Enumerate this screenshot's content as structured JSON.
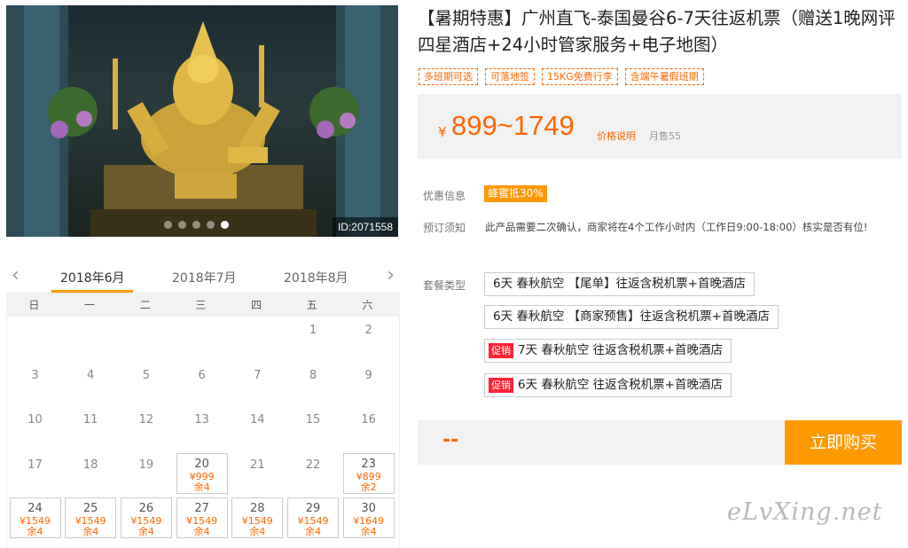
{
  "hero": {
    "id_label": "ID:2071558",
    "slide_count": 5,
    "active_slide": 4
  },
  "calendar": {
    "prev_arrow": "‹",
    "next_arrow": "›",
    "months": [
      "2018年6月",
      "2018年7月",
      "2018年8月"
    ],
    "weekdays": [
      "日",
      "一",
      "二",
      "三",
      "四",
      "五",
      "六"
    ],
    "days": [
      {
        "d": "1"
      },
      {
        "d": "2"
      },
      {
        "d": "3"
      },
      {
        "d": "4"
      },
      {
        "d": "5"
      },
      {
        "d": "6"
      },
      {
        "d": "7"
      },
      {
        "d": "8"
      },
      {
        "d": "9"
      },
      {
        "d": "10"
      },
      {
        "d": "11"
      },
      {
        "d": "12"
      },
      {
        "d": "13"
      },
      {
        "d": "14"
      },
      {
        "d": "15"
      },
      {
        "d": "16"
      },
      {
        "d": "17"
      },
      {
        "d": "18"
      },
      {
        "d": "19"
      },
      {
        "d": "20",
        "price": "¥999",
        "stock": "余4"
      },
      {
        "d": "21"
      },
      {
        "d": "22"
      },
      {
        "d": "23",
        "price": "¥899",
        "stock": "余2"
      },
      {
        "d": "24",
        "price": "¥1549",
        "stock": "余4"
      },
      {
        "d": "25",
        "price": "¥1549",
        "stock": "余4"
      },
      {
        "d": "26",
        "price": "¥1549",
        "stock": "余4"
      },
      {
        "d": "27",
        "price": "¥1549",
        "stock": "余4"
      },
      {
        "d": "28",
        "price": "¥1549",
        "stock": "余4"
      },
      {
        "d": "29",
        "price": "¥1549",
        "stock": "余4"
      },
      {
        "d": "30",
        "price": "¥1649",
        "stock": "余4"
      }
    ]
  },
  "product": {
    "title": "【暑期特惠】广州直飞-泰国曼谷6-7天往返机票（赠送1晚网评四星酒店+24小时管家服务+电子地图）",
    "tags": [
      "多班期可选",
      "可落地签",
      "15KG免费行李",
      "含端午暑假班期"
    ],
    "price_currency": "¥",
    "price_range": "899~1749",
    "price_note": "价格说明",
    "monthly_sales": "月售55"
  },
  "offers": {
    "promo_label": "优惠信息",
    "promo_badge": "蜂蜜抵30%",
    "notice_label": "预订须知",
    "notice_text": "此产品需要二次确认，商家将在4个工作小时内（工作日9:00-18:00）核实是否有位!"
  },
  "packages": {
    "label": "套餐类型",
    "sale_badge": "促销",
    "items": [
      {
        "text": "6天 春秋航空 【尾单】往返含税机票+首晚酒店",
        "sale": false
      },
      {
        "text": "6天 春秋航空 【商家预售】往返含税机票+首晚酒店",
        "sale": false
      },
      {
        "text": "7天 春秋航空 往返含税机票+首晚酒店",
        "sale": true
      },
      {
        "text": "6天 春秋航空 往返含税机票+首晚酒店",
        "sale": true
      }
    ]
  },
  "purchase": {
    "total": "--",
    "buy_label": "立即购买"
  },
  "watermark": "eLvXing.net"
}
